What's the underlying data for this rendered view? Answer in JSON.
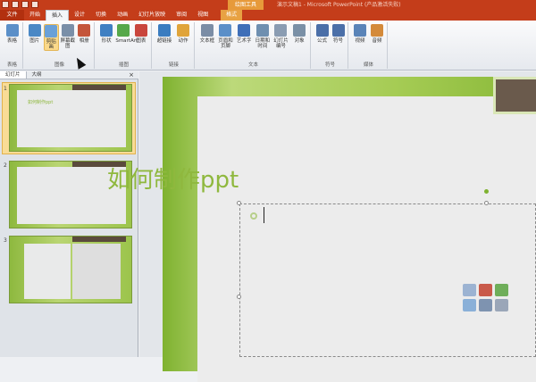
{
  "window": {
    "doc_title": "演示文稿1 - Microsoft PowerPoint (产品激活失败)",
    "contextual_tab_group": "绘图工具"
  },
  "tabs": [
    {
      "label": "文件",
      "kind": "file"
    },
    {
      "label": "开始",
      "kind": "normal"
    },
    {
      "label": "插入",
      "kind": "active"
    },
    {
      "label": "设计",
      "kind": "normal"
    },
    {
      "label": "切换",
      "kind": "normal"
    },
    {
      "label": "动画",
      "kind": "normal"
    },
    {
      "label": "幻灯片放映",
      "kind": "normal"
    },
    {
      "label": "审阅",
      "kind": "normal"
    },
    {
      "label": "视图",
      "kind": "normal"
    },
    {
      "label": "格式",
      "kind": "format"
    }
  ],
  "ribbon": {
    "groups": [
      {
        "label": "表格",
        "buttons": [
          {
            "label": "表格",
            "icon": "table-icon",
            "color": "#5b8fc8"
          }
        ]
      },
      {
        "label": "图像",
        "buttons": [
          {
            "label": "图片",
            "icon": "picture-icon",
            "color": "#4a88c5"
          },
          {
            "label": "剪贴画",
            "icon": "clipart-icon",
            "color": "#6aa0d8",
            "highlight": true
          },
          {
            "label": "屏幕截图",
            "icon": "screenshot-icon",
            "color": "#7a8fa8"
          },
          {
            "label": "相册",
            "icon": "album-icon",
            "color": "#c4553a"
          }
        ]
      },
      {
        "label": "插图",
        "buttons": [
          {
            "label": "形状",
            "icon": "shapes-icon",
            "color": "#3f7fc2"
          },
          {
            "label": "SmartArt",
            "icon": "smartart-icon",
            "color": "#56a84a"
          },
          {
            "label": "图表",
            "icon": "chart-icon",
            "color": "#c9463d"
          }
        ]
      },
      {
        "label": "链接",
        "buttons": [
          {
            "label": "超链接",
            "icon": "hyperlink-icon",
            "color": "#3a7cc0"
          },
          {
            "label": "动作",
            "icon": "action-icon",
            "color": "#e0a43a"
          }
        ]
      },
      {
        "label": "文本",
        "buttons": [
          {
            "label": "文本框",
            "icon": "textbox-icon",
            "color": "#7b8da5"
          },
          {
            "label": "页眉和页脚",
            "icon": "header-footer-icon",
            "color": "#5b8fc8"
          },
          {
            "label": "艺术字",
            "icon": "wordart-icon",
            "color": "#3f6fb8"
          },
          {
            "label": "日期和时间",
            "icon": "datetime-icon",
            "color": "#6f8fb0"
          },
          {
            "label": "幻灯片编号",
            "icon": "slide-number-icon",
            "color": "#8a9cb2"
          },
          {
            "label": "对象",
            "icon": "object-icon",
            "color": "#7a90a6"
          }
        ]
      },
      {
        "label": "符号",
        "buttons": [
          {
            "label": "公式",
            "icon": "pi-icon",
            "color": "#4b6fa8"
          },
          {
            "label": "符号",
            "icon": "omega-icon",
            "color": "#4b6fa8"
          }
        ]
      },
      {
        "label": "媒体",
        "buttons": [
          {
            "label": "视频",
            "icon": "video-icon",
            "color": "#5a84b8"
          },
          {
            "label": "音频",
            "icon": "audio-icon",
            "color": "#d48a3a"
          }
        ]
      }
    ]
  },
  "left_panel": {
    "tabs": [
      "幻灯片",
      "大纲"
    ],
    "close": "×",
    "slides": [
      {
        "number": "1",
        "title": "如何制作ppt",
        "selected": true
      },
      {
        "number": "2",
        "title": "",
        "selected": false
      },
      {
        "number": "3",
        "title": "",
        "selected": false
      }
    ]
  },
  "slide": {
    "title": "如何制作ppt"
  },
  "colors": {
    "ribbon_tab_bar": "#c43d1a",
    "slide_green": "#8fb83e",
    "selected_thumb": "#f9dc96"
  }
}
